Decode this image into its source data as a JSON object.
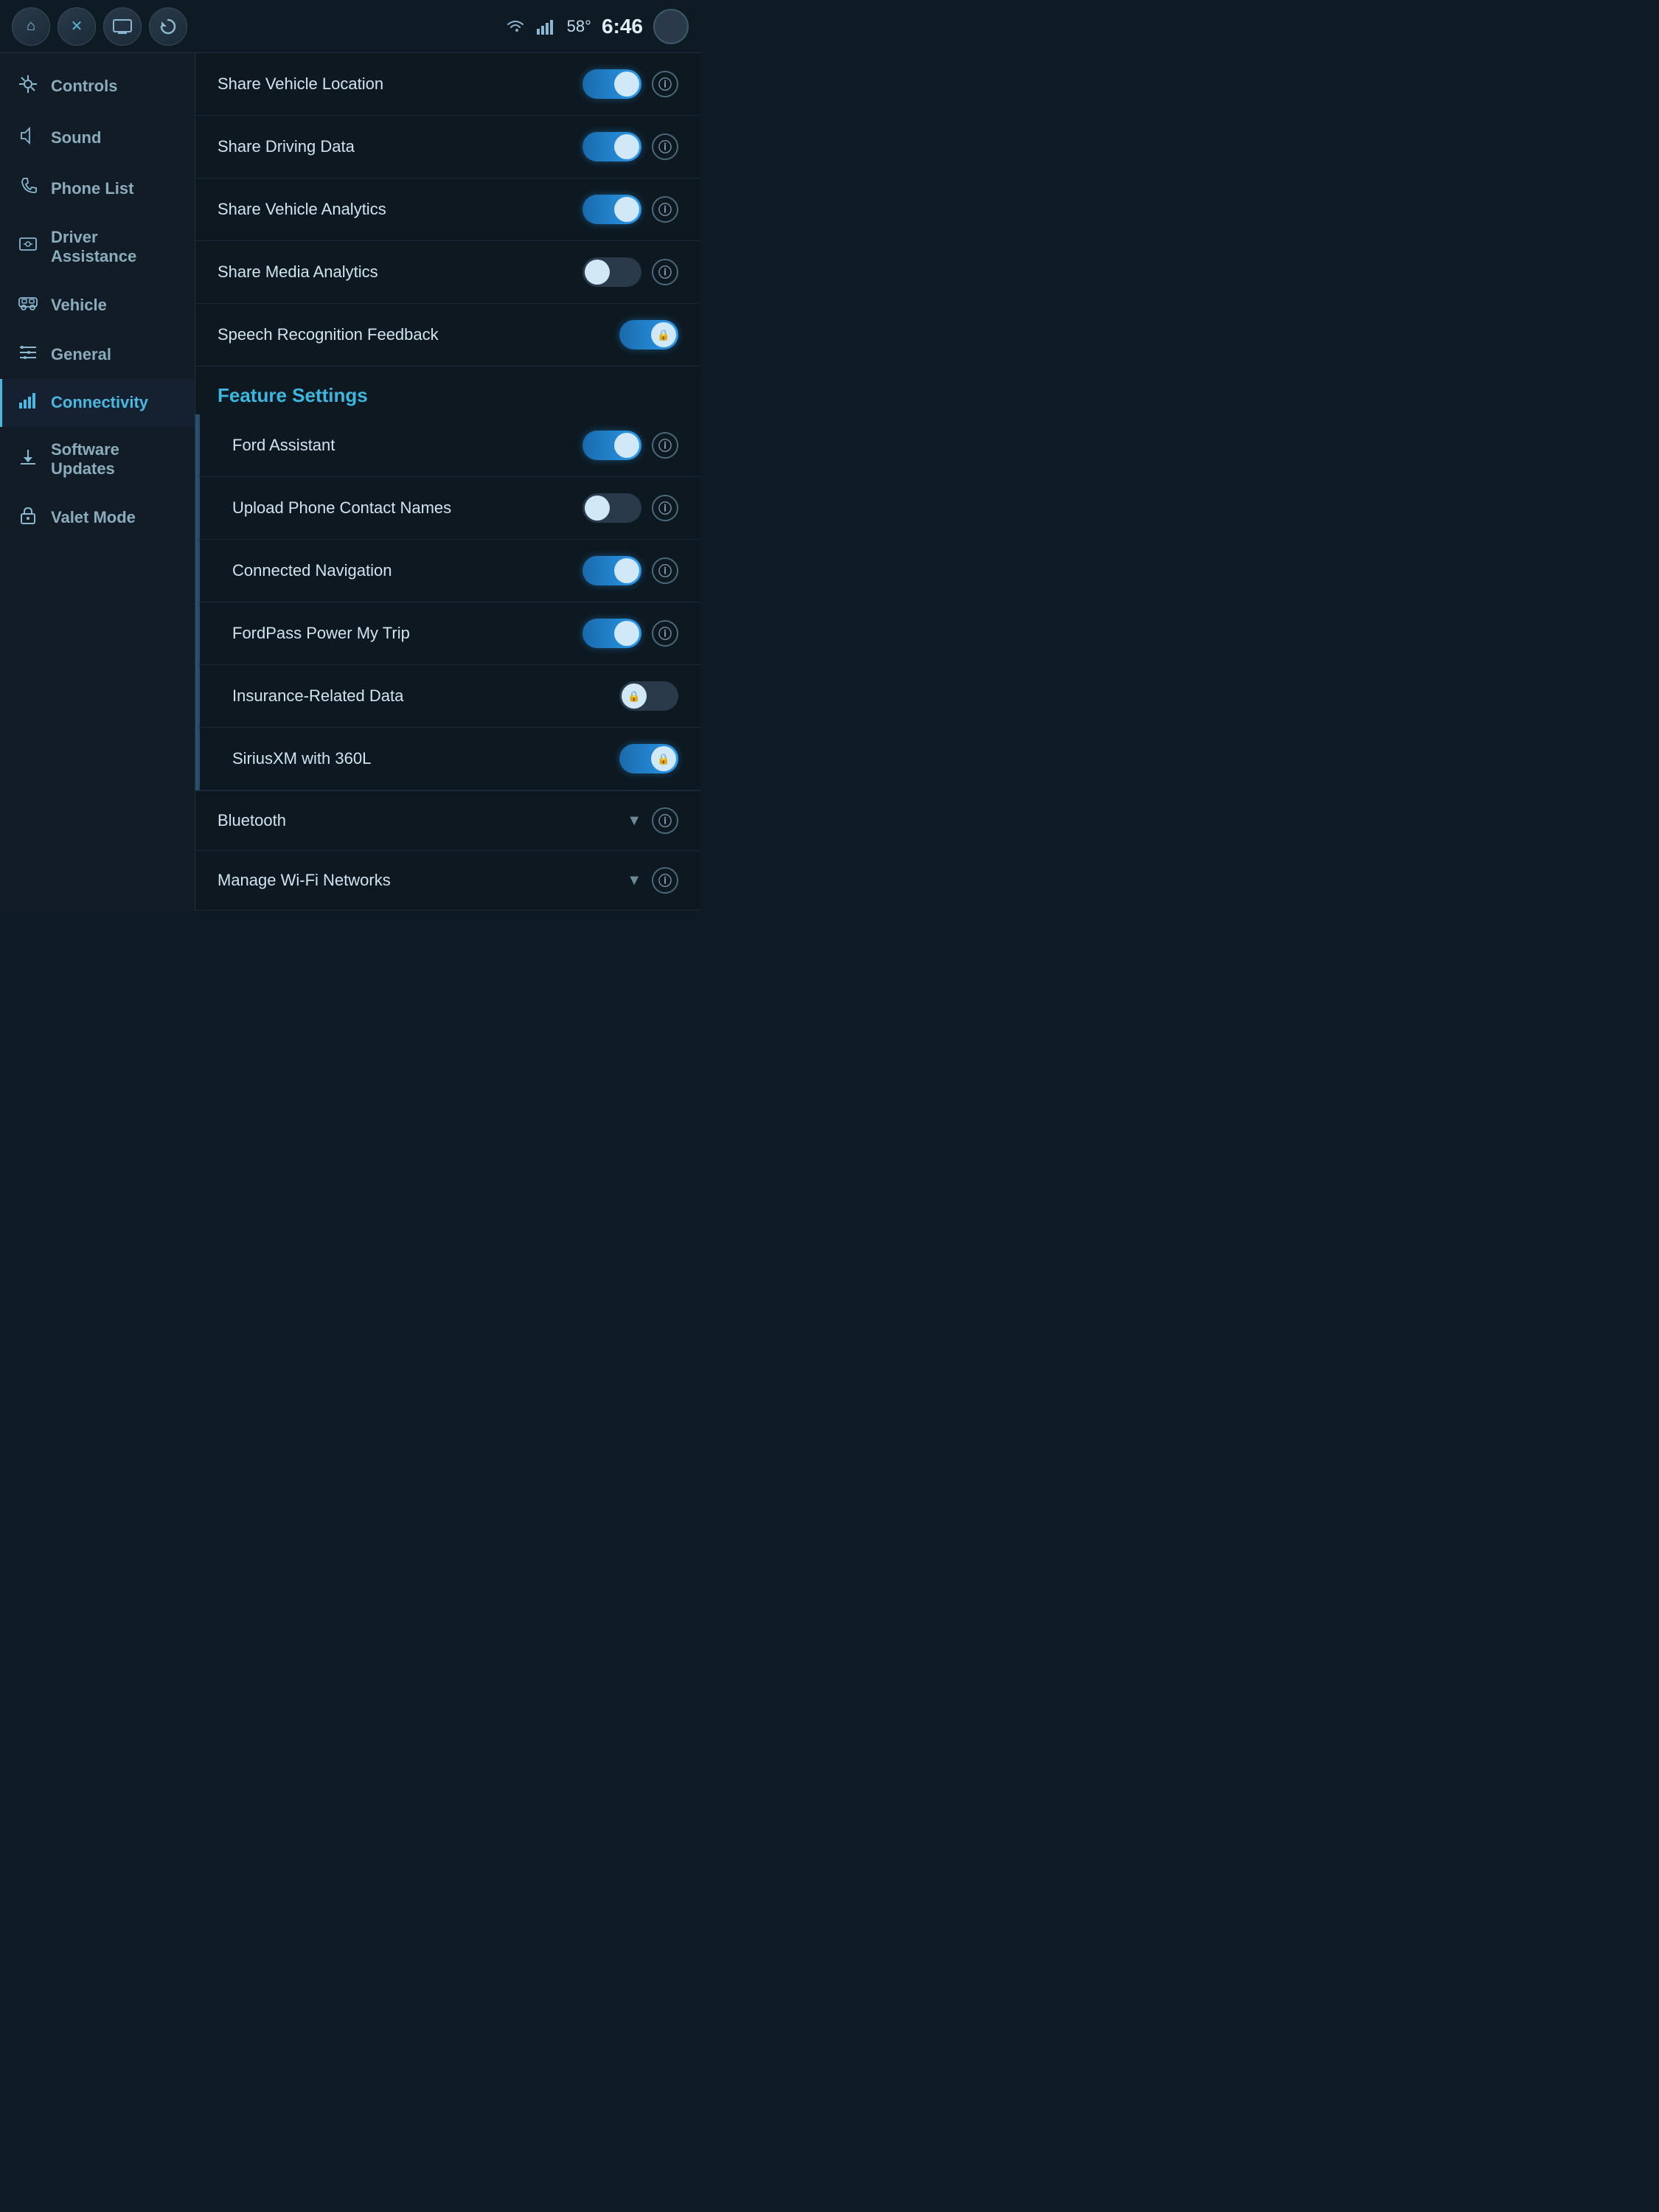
{
  "topbar": {
    "home_label": "⌂",
    "close_label": "✕",
    "media_label": "⊡",
    "refresh_label": "↺",
    "wifi_icon": "wifi",
    "signal_icon": "signal",
    "temperature": "58°",
    "time": "6:46"
  },
  "sidebar": {
    "items": [
      {
        "id": "controls",
        "label": "Controls",
        "icon": "⚙"
      },
      {
        "id": "sound",
        "label": "Sound",
        "icon": "🔊"
      },
      {
        "id": "phone-list",
        "label": "Phone List",
        "icon": "📞"
      },
      {
        "id": "driver-assistance",
        "label": "Driver\nAssistance",
        "icon": "🪟"
      },
      {
        "id": "vehicle",
        "label": "Vehicle",
        "icon": "🚗"
      },
      {
        "id": "general",
        "label": "General",
        "icon": "≡"
      },
      {
        "id": "connectivity",
        "label": "Connectivity",
        "icon": "📶",
        "active": true
      },
      {
        "id": "software-updates",
        "label": "Software\nUpdates",
        "icon": "⬇"
      },
      {
        "id": "valet-mode",
        "label": "Valet Mode",
        "icon": "🔒"
      }
    ]
  },
  "content": {
    "main_toggles": [
      {
        "id": "share-vehicle-location",
        "label": "Share Vehicle Location",
        "state": "on",
        "locked": false
      },
      {
        "id": "share-driving-data",
        "label": "Share Driving Data",
        "state": "on",
        "locked": false
      },
      {
        "id": "share-vehicle-analytics",
        "label": "Share Vehicle Analytics",
        "state": "on",
        "locked": false
      },
      {
        "id": "share-media-analytics",
        "label": "Share Media Analytics",
        "state": "off",
        "locked": false
      },
      {
        "id": "speech-recognition-feedback",
        "label": "Speech Recognition Feedback",
        "state": "on",
        "locked": true
      }
    ],
    "feature_settings_title": "Feature Settings",
    "feature_toggles": [
      {
        "id": "ford-assistant",
        "label": "Ford Assistant",
        "state": "on",
        "locked": false
      },
      {
        "id": "upload-phone-contact-names",
        "label": "Upload Phone Contact Names",
        "state": "off",
        "locked": false
      },
      {
        "id": "connected-navigation",
        "label": "Connected Navigation",
        "state": "on",
        "locked": false
      },
      {
        "id": "fordpass-power-my-trip",
        "label": "FordPass Power My Trip",
        "state": "on",
        "locked": false
      },
      {
        "id": "insurance-related-data",
        "label": "Insurance-Related Data",
        "state": "off",
        "locked": true
      },
      {
        "id": "siriusxm-360l",
        "label": "SiriusXM with 360L",
        "state": "on",
        "locked": true
      }
    ],
    "bluetooth_label": "Bluetooth",
    "wifi_label": "Manage Wi-Fi Networks"
  }
}
